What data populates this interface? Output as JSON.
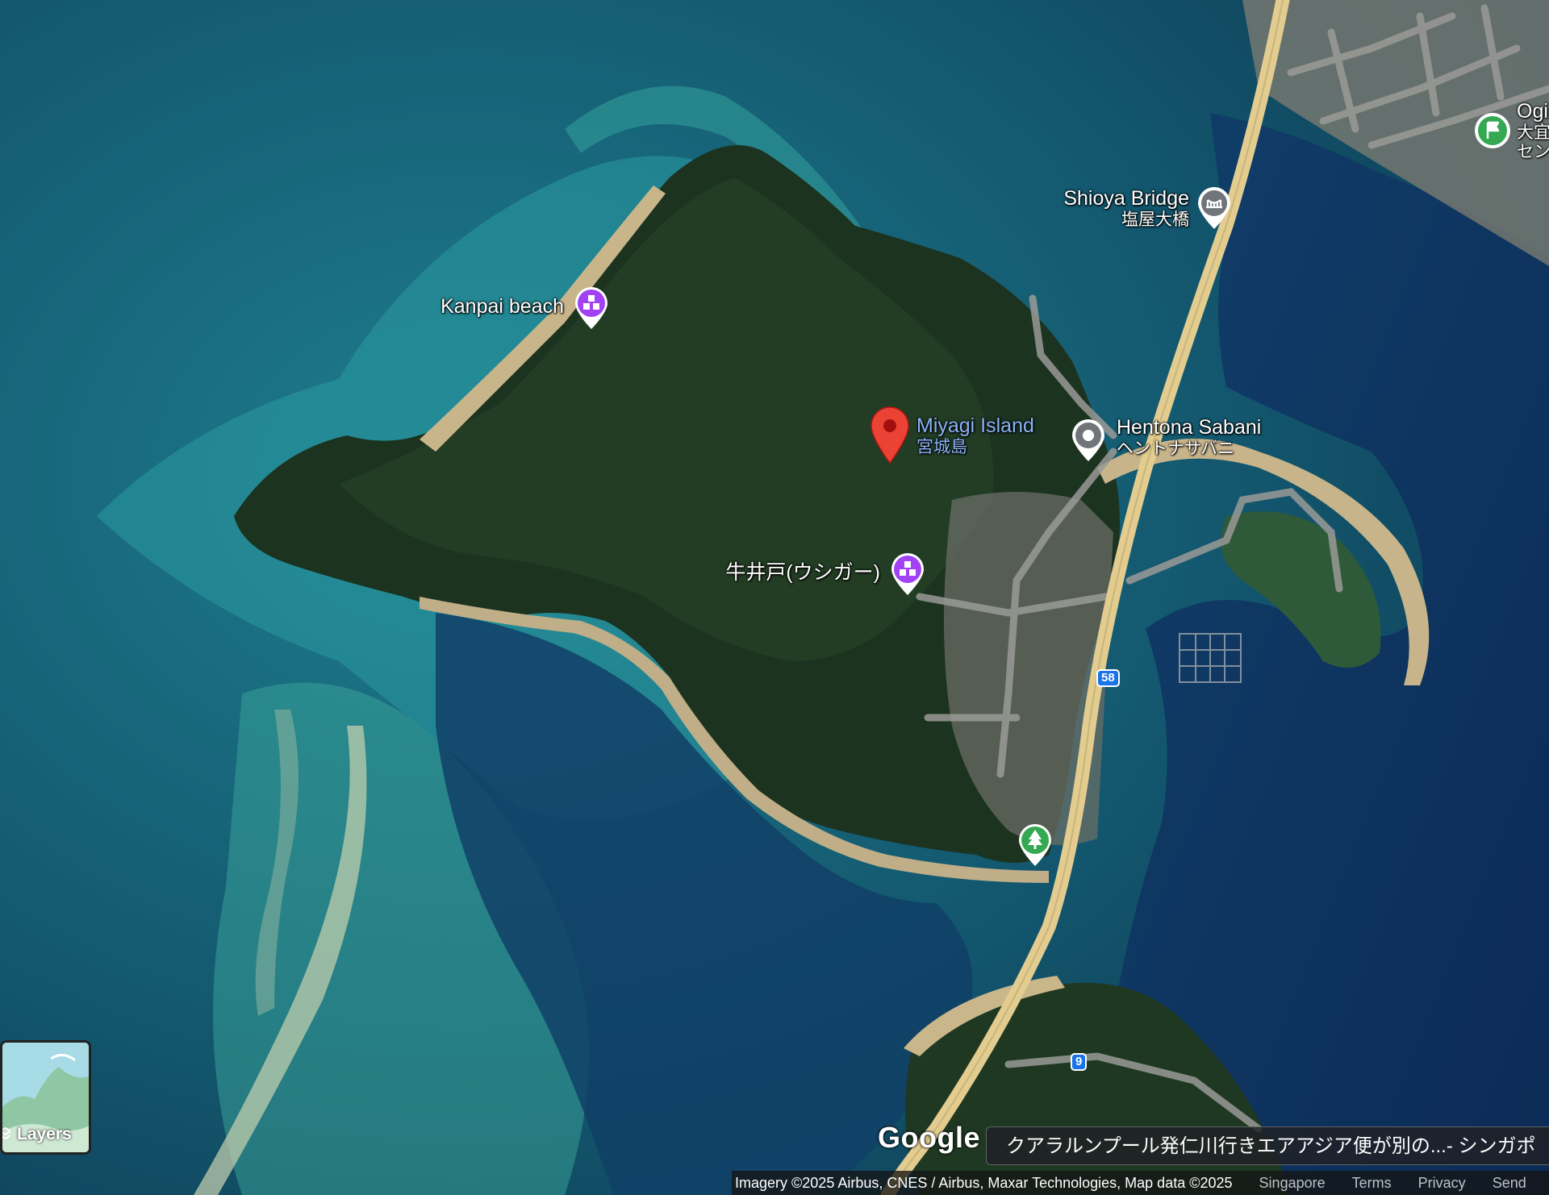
{
  "places": {
    "shioya_bridge": {
      "name": "Shioya Bridge",
      "local": "塩屋大橋"
    },
    "kanpai_beach": {
      "name": "Kanpai beach"
    },
    "miyagi_island": {
      "name": "Miyagi Island",
      "local": "宮城島"
    },
    "hentona_sabani": {
      "name": "Hentona Sabani",
      "local": "ヘントナサバニ"
    },
    "ushigaa": {
      "name": "牛井戸(ウシガー)"
    },
    "ogimi": {
      "name": "Ogi",
      "local1": "大宜",
      "local2": "セン"
    }
  },
  "routes": {
    "r58": "58",
    "r9": "9"
  },
  "controls": {
    "layers_label": "Layers"
  },
  "branding": {
    "google": "Google"
  },
  "news_banner": "クアラルンプール発仁川行きエアアジア便が別の...- シンガポ",
  "footer": {
    "imagery": "Imagery ©2025 Airbus, CNES / Airbus, Maxar Technologies, Map data ©2025",
    "region": "Singapore",
    "terms": "Terms",
    "privacy": "Privacy",
    "send": "Send"
  },
  "colors": {
    "selected_pin": "#ea4335",
    "activity_poi": "#a142f4",
    "park_poi": "#34a853",
    "route_shield": "#1a73e8",
    "road": "#e8d49a"
  },
  "icons": {
    "selected": "map-pin-icon",
    "kanpai": "activity-icon",
    "ushigaa": "activity-icon",
    "bridge": "bridge-icon",
    "hentona": "place-dot-icon",
    "park": "tree-icon",
    "ogimi": "flag-icon",
    "layers": "layers-icon"
  }
}
